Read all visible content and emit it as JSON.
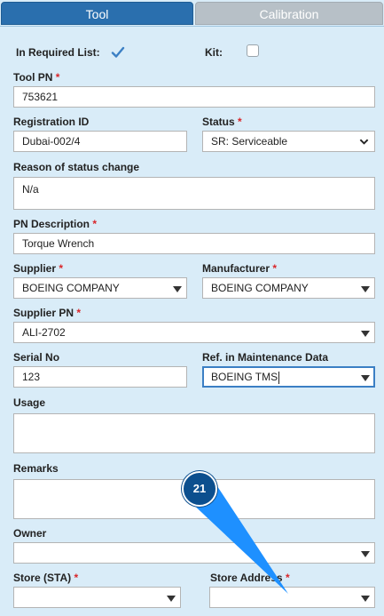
{
  "tabs": [
    {
      "label": "Tool",
      "active": true
    },
    {
      "label": "Calibration",
      "active": false
    }
  ],
  "form": {
    "in_required_list": {
      "label": "In Required List:",
      "checked": true
    },
    "kit": {
      "label": "Kit:",
      "checked": false
    },
    "tool_pn": {
      "label": "Tool PN",
      "required": "*",
      "value": "753621"
    },
    "registration_id": {
      "label": "Registration ID",
      "value": "Dubai-002/4"
    },
    "status": {
      "label": "Status",
      "required": "*",
      "value": "SR: Serviceable"
    },
    "reason": {
      "label": "Reason of status change",
      "value": "N/a"
    },
    "pn_description": {
      "label": "PN Description",
      "required": "*",
      "value": "Torque Wrench"
    },
    "supplier": {
      "label": "Supplier",
      "required": "*",
      "value": "BOEING COMPANY"
    },
    "manufacturer": {
      "label": "Manufacturer",
      "required": "*",
      "value": "BOEING COMPANY"
    },
    "supplier_pn": {
      "label": "Supplier PN",
      "required": "*",
      "value": "ALI-2702"
    },
    "serial_no": {
      "label": "Serial No",
      "value": "123"
    },
    "ref_maintenance": {
      "label": "Ref. in Maintenance Data",
      "value": "BOEING TMS"
    },
    "usage": {
      "label": "Usage",
      "value": ""
    },
    "remarks": {
      "label": "Remarks",
      "value": ""
    },
    "owner": {
      "label": "Owner",
      "value": ""
    },
    "store_sta": {
      "label": "Store (STA)",
      "required": "*",
      "value": ""
    },
    "store_address": {
      "label": "Store Address",
      "required": "*",
      "value": ""
    }
  },
  "callout": {
    "number": "21",
    "color": "#1e90ff"
  },
  "colors": {
    "accent": "#2a6fae",
    "background": "#d9ecf8",
    "required": "#d9262a"
  }
}
